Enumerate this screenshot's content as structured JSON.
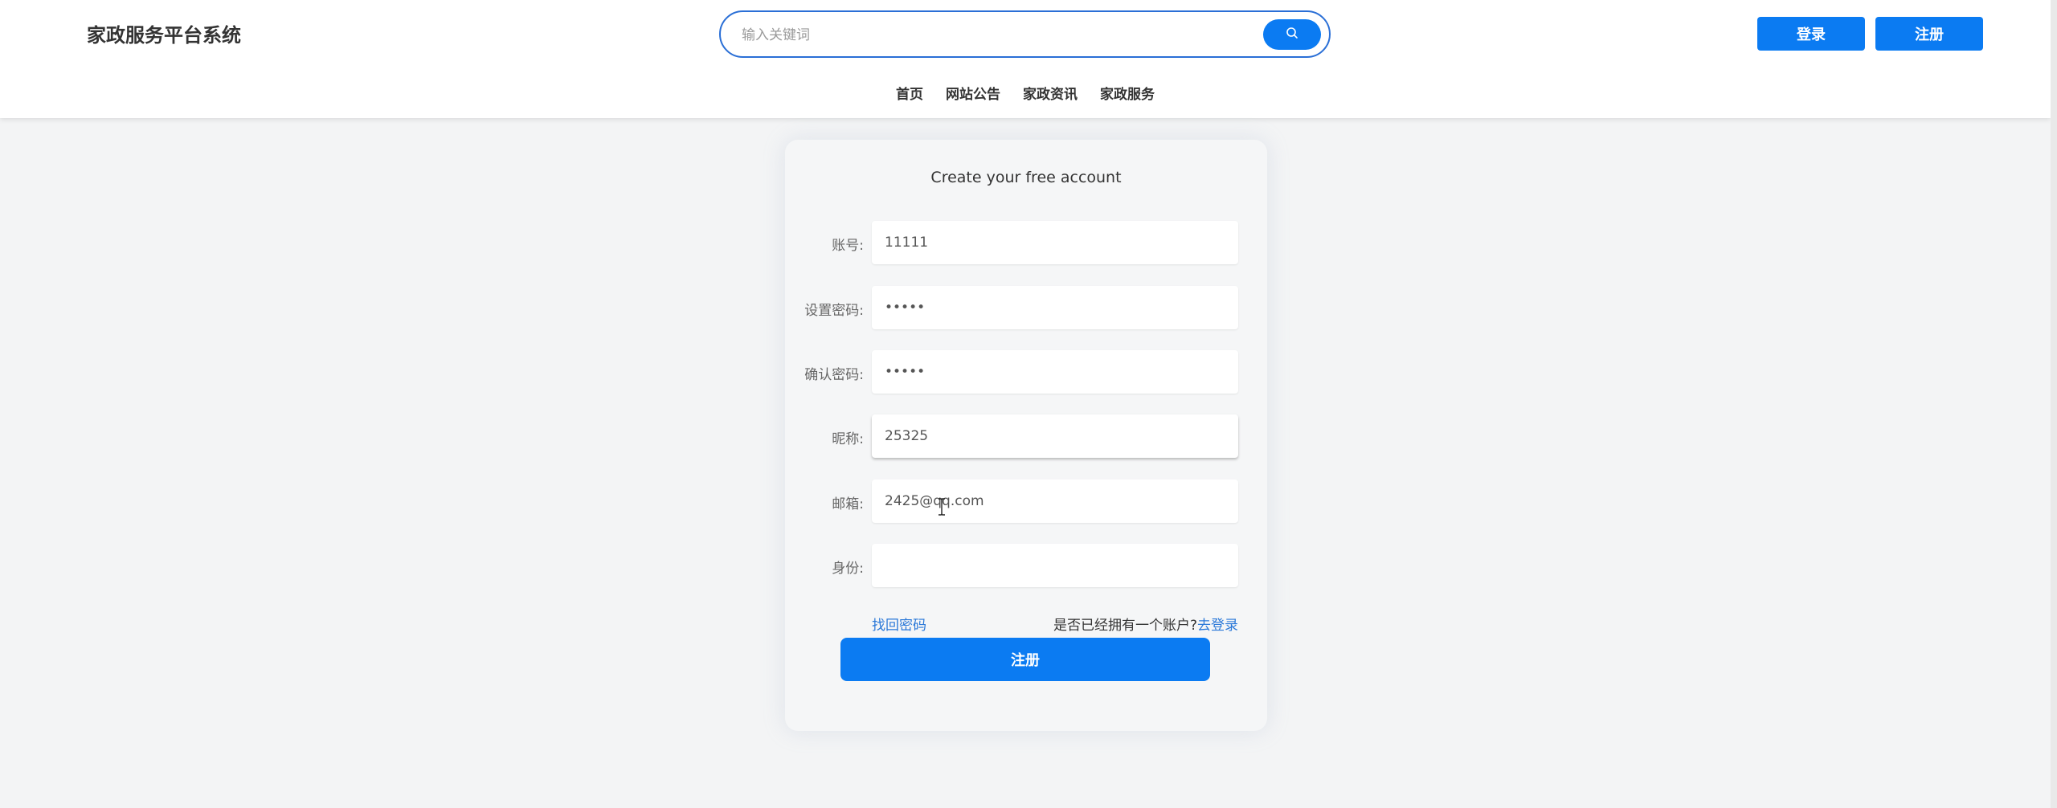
{
  "header": {
    "brand": "家政服务平台系统",
    "search_placeholder": "输入关键词",
    "login_label": "登录",
    "register_label": "注册",
    "nav": [
      {
        "label": "首页"
      },
      {
        "label": "网站公告"
      },
      {
        "label": "家政资讯"
      },
      {
        "label": "家政服务"
      }
    ]
  },
  "form": {
    "title": "Create your free account",
    "fields": [
      {
        "label": "账号:",
        "value": "11111",
        "type": "text"
      },
      {
        "label": "设置密码:",
        "value": "11111",
        "type": "password"
      },
      {
        "label": "确认密码:",
        "value": "11111",
        "type": "password"
      },
      {
        "label": "昵称:",
        "value": "25325",
        "type": "text"
      },
      {
        "label": "邮箱:",
        "value": "2425@qq.com",
        "type": "text"
      },
      {
        "label": "身份:",
        "value": "",
        "type": "text"
      }
    ],
    "forgot_password": "找回密码",
    "account_hint": "是否已经拥有一个账户?",
    "goto_login": "去登录",
    "submit_label": "注册"
  },
  "colors": {
    "accent": "#0b7bf2",
    "link": "#2a78d8",
    "background": "#f3f4f5"
  }
}
